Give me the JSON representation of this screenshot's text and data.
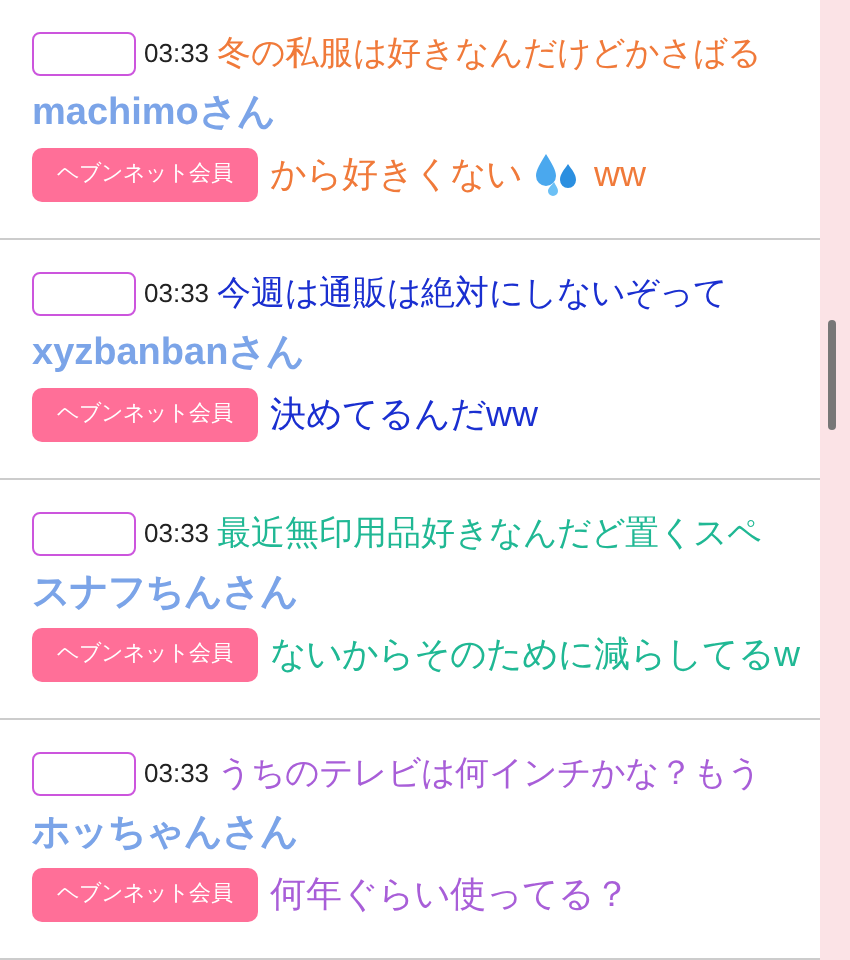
{
  "posts": [
    {
      "time": "03:33",
      "name": "machimoさん",
      "badge": "ヘブンネット会員",
      "caption": {
        "line1": "冬の私服は好きなんだけどかさばる",
        "line2": "から好きくない",
        "line2_suffix": "ww",
        "color": "#f07a3a"
      }
    },
    {
      "time": "03:33",
      "name": "xyzbanbanさん",
      "badge": "ヘブンネット会員",
      "caption": {
        "line1": "今週は通販は絶対にしないぞって",
        "line2": "決めてるんだww",
        "color": "#1a2fd0"
      }
    },
    {
      "time": "03:33",
      "name": "スナフちんさん",
      "badge": "ヘブンネット会員",
      "caption": {
        "line1": "最近無印用品好きなんだど置くスペ",
        "line2": "ないからそのために減らしてるw",
        "color": "#20b894"
      }
    },
    {
      "time": "03:33",
      "name": "ホッちゃんさん",
      "badge": "ヘブンネット会員",
      "caption": {
        "line1": "うちのテレビは何インチかな？もう",
        "line2": "何年ぐらい使ってる？",
        "color": "#a85ed8"
      }
    }
  ]
}
